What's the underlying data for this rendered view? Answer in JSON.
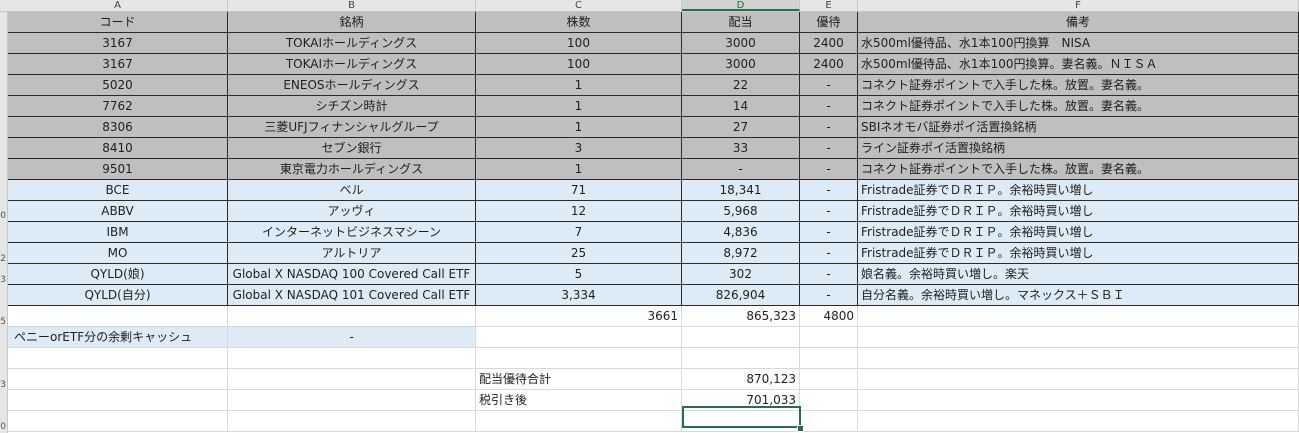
{
  "columns": [
    "A",
    "B",
    "C",
    "D",
    "E",
    "F"
  ],
  "rownums": [
    "",
    "",
    "",
    "",
    "",
    "",
    "",
    "",
    "",
    "",
    "0",
    "",
    "2",
    "3",
    "",
    "5",
    "",
    "",
    "3",
    "",
    "0"
  ],
  "header": [
    "コード",
    "銘柄",
    "株数",
    "配当",
    "優待",
    "備考"
  ],
  "rows": [
    {
      "style": "grey",
      "code": "3167",
      "name": "TOKAIホールディングス",
      "shares": "100",
      "dividend": "3000",
      "yutai": "2400",
      "note": "水500ml優待品、水1本100円換算　NISA"
    },
    {
      "style": "grey",
      "code": "3167",
      "name": "TOKAIホールディングス",
      "shares": "100",
      "dividend": "3000",
      "yutai": "2400",
      "note": "水500ml優待品、水1本100円換算。妻名義。ＮＩＳＡ"
    },
    {
      "style": "grey",
      "code": "5020",
      "name": "ENEOSホールディングス",
      "shares": "1",
      "dividend": "22",
      "yutai": "-",
      "note": "コネクト証券ポイントで入手した株。放置。妻名義。"
    },
    {
      "style": "grey",
      "code": "7762",
      "name": "シチズン時計",
      "shares": "1",
      "dividend": "14",
      "yutai": "-",
      "note": "コネクト証券ポイントで入手した株。放置。妻名義。"
    },
    {
      "style": "grey",
      "code": "8306",
      "name": "三菱UFJフィナンシャルグループ",
      "shares": "1",
      "dividend": "27",
      "yutai": "-",
      "note": "SBIネオモバ証券ポイ活置換銘柄"
    },
    {
      "style": "grey",
      "code": "8410",
      "name": "セブン銀行",
      "shares": "3",
      "dividend": "33",
      "yutai": "-",
      "note": "ライン証券ポイ活置換銘柄"
    },
    {
      "style": "grey",
      "code": "9501",
      "name": "東京電力ホールディングス",
      "shares": "1",
      "dividend": "-",
      "yutai": "-",
      "note": "コネクト証券ポイントで入手した株。放置。妻名義。"
    },
    {
      "style": "blue",
      "code": "BCE",
      "name": "ベル",
      "shares": "71",
      "dividend": "18,341",
      "yutai": "-",
      "note": "Fristrade証券でＤＲＩＰ。余裕時買い増し"
    },
    {
      "style": "blue",
      "code": "ABBV",
      "name": "アッヴィ",
      "shares": "12",
      "dividend": "5,968",
      "yutai": "-",
      "note": "Fristrade証券でＤＲＩＰ。余裕時買い増し"
    },
    {
      "style": "blue",
      "code": "IBM",
      "name": "インターネットビジネスマシーン",
      "shares": "7",
      "dividend": "4,836",
      "yutai": "-",
      "note": "Fristrade証券でＤＲＩＰ。余裕時買い増し"
    },
    {
      "style": "blue",
      "code": "MO",
      "name": "アルトリア",
      "shares": "25",
      "dividend": "8,972",
      "yutai": "-",
      "note": "Fristrade証券でＤＲＩＰ。余裕時買い増し"
    },
    {
      "style": "blue",
      "code": "QYLD(娘)",
      "name": "Global X NASDAQ 100 Covered Call ETF",
      "shares": "5",
      "dividend": "302",
      "yutai": "-",
      "note": "娘名義。余裕時買い増し。楽天"
    },
    {
      "style": "blue",
      "code": "QYLD(自分)",
      "name": "Global X NASDAQ 101 Covered Call ETF",
      "shares": "3,334",
      "dividend": "826,904",
      "yutai": "-",
      "note": "自分名義。余裕時買い増し。マネックス＋ＳＢＩ"
    }
  ],
  "totals": {
    "shares": "3661",
    "dividend": "865,323",
    "yutai": "4800"
  },
  "cash": {
    "label": "ペニーorETF分の余剰キャッシュ",
    "value": "-"
  },
  "summary": [
    {
      "label": "配当優待合計",
      "value": "870,123"
    },
    {
      "label": "税引き後",
      "value": "701,033"
    }
  ]
}
